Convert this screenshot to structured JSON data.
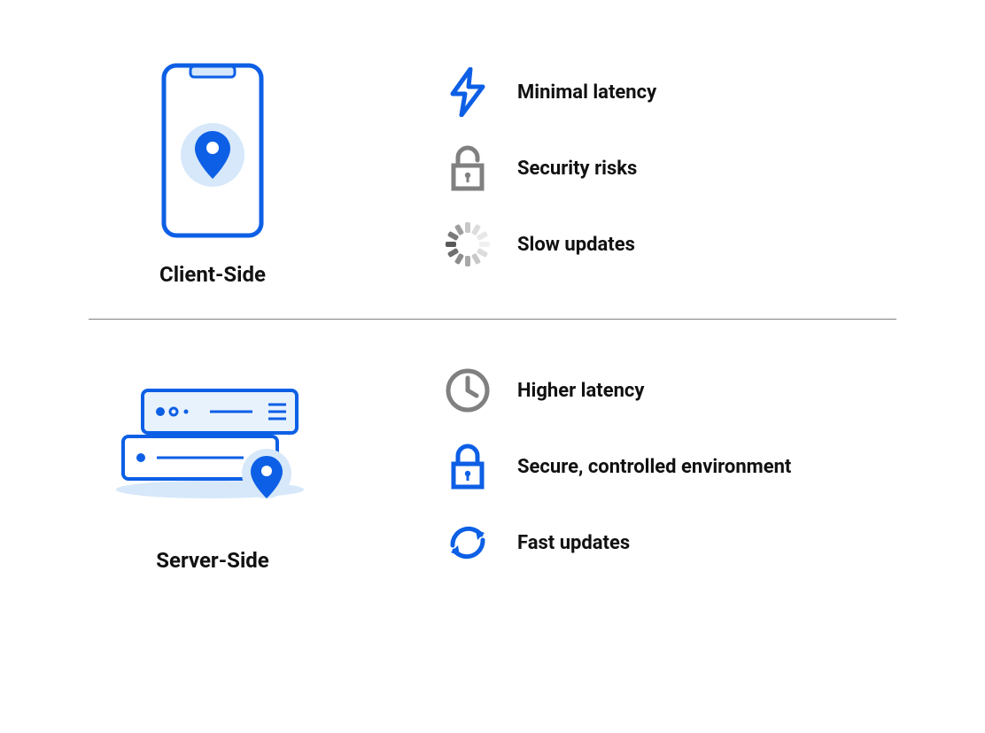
{
  "sections": {
    "client": {
      "title": "Client-Side",
      "features": [
        {
          "label": "Minimal latency",
          "icon": "lightning"
        },
        {
          "label": "Security risks",
          "icon": "unlocked"
        },
        {
          "label": "Slow updates",
          "icon": "spinner"
        }
      ]
    },
    "server": {
      "title": "Server-Side",
      "features": [
        {
          "label": "Higher latency",
          "icon": "clock"
        },
        {
          "label": "Secure, controlled environment",
          "icon": "locked"
        },
        {
          "label": "Fast updates",
          "icon": "refresh"
        }
      ]
    }
  },
  "colors": {
    "blue": "#0d5fe5",
    "blue_light": "#d6e8fa",
    "gray": "#808080",
    "gray_light": "#d0d0d0"
  }
}
